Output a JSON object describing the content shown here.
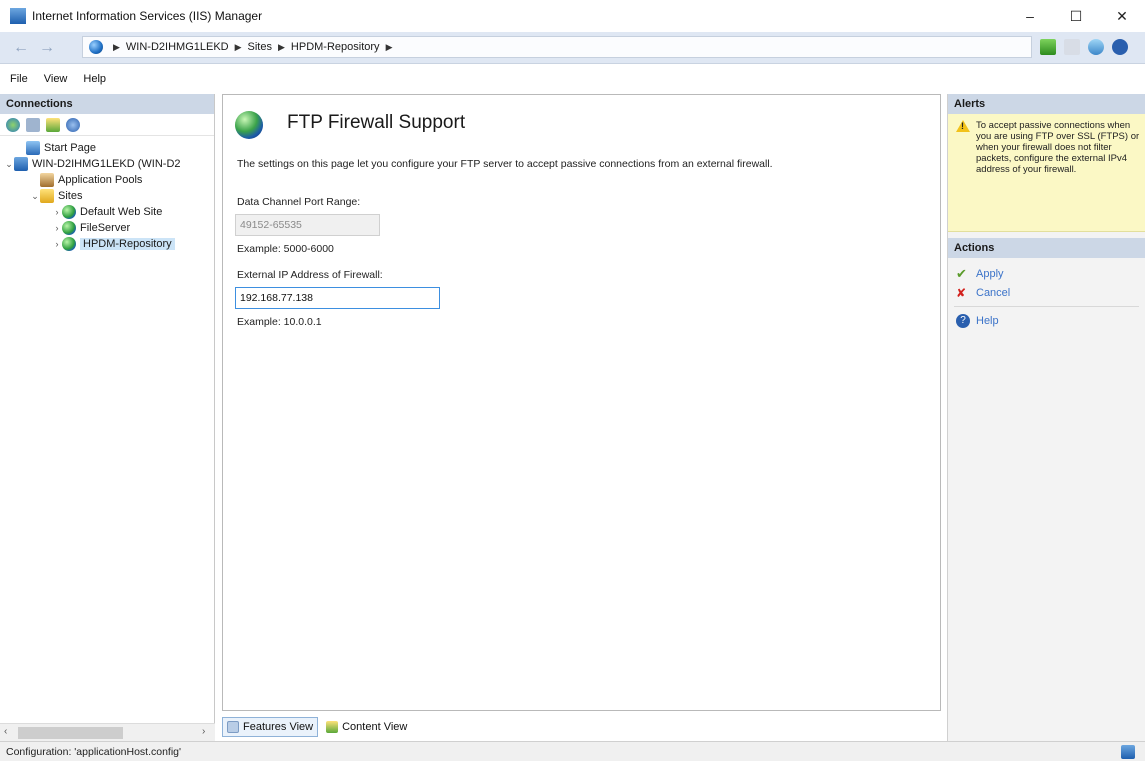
{
  "window": {
    "title": "Internet Information Services (IIS) Manager",
    "minimize_glyph": "–",
    "maximize_glyph": "☐",
    "close_glyph": "✕"
  },
  "address_bar": {
    "back_glyph": "←",
    "forward_glyph": "→",
    "crumbs": [
      "WIN-D2IHMG1LEKD",
      "Sites",
      "HPDM-Repository"
    ]
  },
  "menu": {
    "items": [
      "File",
      "View",
      "Help"
    ]
  },
  "connections": {
    "header": "Connections",
    "tree": [
      {
        "label": "Start Page",
        "icon": "start-page-icon"
      },
      {
        "label": "WIN-D2IHMG1LEKD (WIN-D2",
        "icon": "server-icon",
        "expanded": true
      },
      {
        "label": "Application Pools",
        "icon": "application-pools-icon"
      },
      {
        "label": "Sites",
        "icon": "sites-folder-icon",
        "expanded": true
      },
      {
        "label": "Default Web Site",
        "icon": "globe-icon"
      },
      {
        "label": "FileServer",
        "icon": "globe-icon"
      },
      {
        "label": "HPDM-Repository",
        "icon": "globe-icon",
        "selected": true
      }
    ]
  },
  "feature": {
    "title": "FTP Firewall Support",
    "description": "The settings on this page let you configure your FTP server to accept passive connections from an external firewall.",
    "port_range_label": "Data Channel Port Range:",
    "port_range_value": "49152-65535",
    "port_range_example": "Example: 5000-6000",
    "external_ip_label": "External IP Address of Firewall:",
    "external_ip_value": "192.168.77.138",
    "external_ip_example": "Example: 10.0.0.1"
  },
  "bottom_tabs": {
    "features_view": "Features View",
    "content_view": "Content View"
  },
  "alerts": {
    "header": "Alerts",
    "message": "To accept passive connections when you are using FTP over SSL (FTPS) or when your firewall does not filter packets, configure the external IPv4 address of your firewall."
  },
  "actions": {
    "header": "Actions",
    "apply": "Apply",
    "cancel": "Cancel",
    "help": "Help"
  },
  "status": {
    "text": "Configuration: 'applicationHost.config'"
  },
  "colors": {
    "pane_header": "#ccd7e6",
    "alert_background": "#fbf8c5",
    "link_blue": "#3b73c9",
    "selection": "#cce4f7"
  }
}
